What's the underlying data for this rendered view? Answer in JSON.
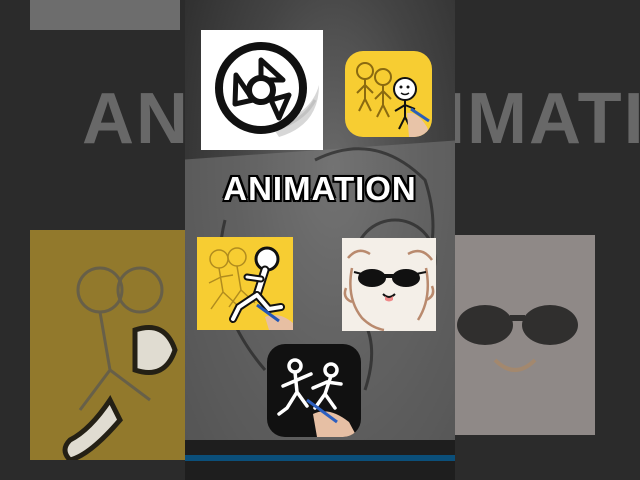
{
  "overlay": {
    "title": "ANIMATION"
  },
  "backdrop": {
    "side_text": "ANIMATION"
  },
  "apps": [
    {
      "name": "flipaclip-style",
      "icon": "film-reel-swirl-icon"
    },
    {
      "name": "stick-figure-trio",
      "icon": "stick-figures-drawing-icon"
    },
    {
      "name": "running-figure",
      "icon": "running-stickman-onion-skin-icon"
    },
    {
      "name": "sunglasses-ghost",
      "icon": "sunglasses-bunny-icon"
    },
    {
      "name": "stick-fight",
      "icon": "stick-fight-icon"
    }
  ],
  "colors": {
    "yellow": "#f7cd32",
    "dark": "#111111",
    "cream": "#f4efe8"
  }
}
